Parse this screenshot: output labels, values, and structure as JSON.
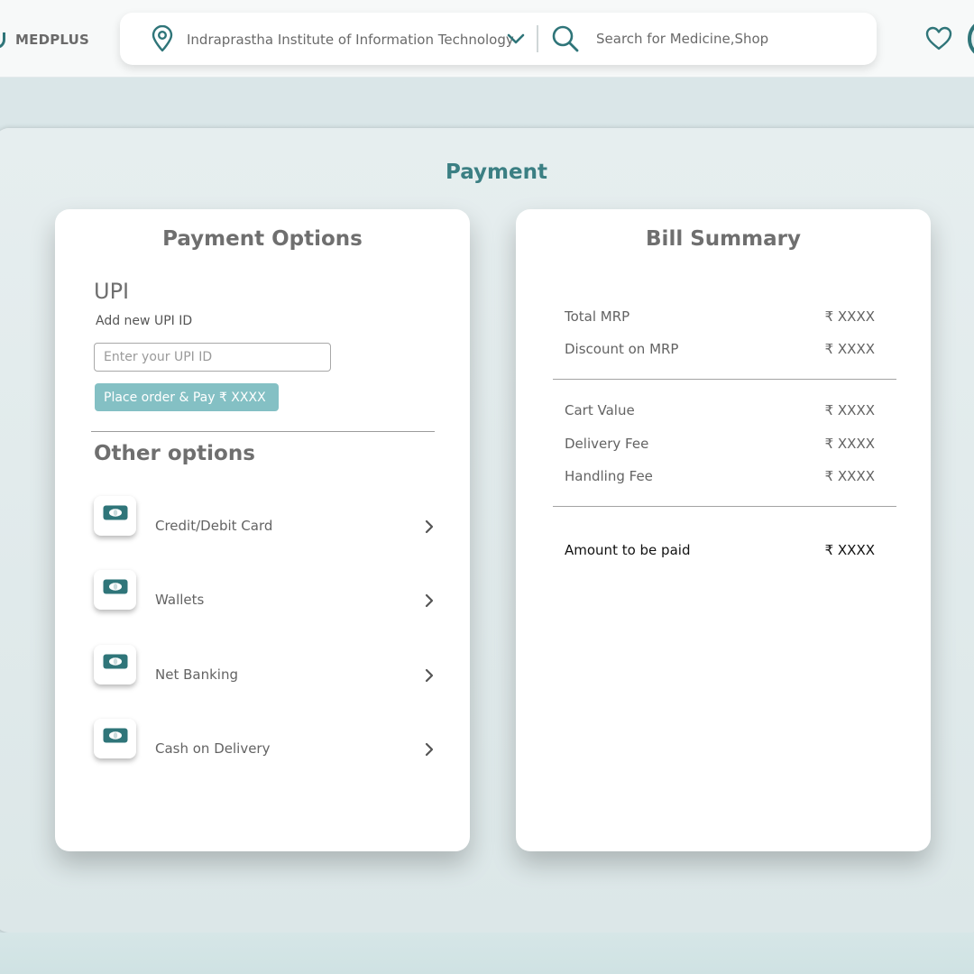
{
  "header": {
    "brand": "MEDPLUS",
    "location": "Indraprastha Institute of Information Technology",
    "search_placeholder": "Search for Medicine,Shop"
  },
  "page": {
    "title": "Payment"
  },
  "payment_options": {
    "title": "Payment Options",
    "upi_heading": "UPI",
    "upi_sub": "Add new UPI ID",
    "upi_placeholder": "Enter your UPI ID",
    "pay_button": "Place order & Pay ₹ XXXX",
    "other_heading": "Other options",
    "options": [
      {
        "label": "Credit/Debit Card"
      },
      {
        "label": "Wallets"
      },
      {
        "label": "Net Banking"
      },
      {
        "label": "Cash on Delivery"
      }
    ]
  },
  "bill_summary": {
    "title": "Bill Summary",
    "rows": [
      {
        "label": "Total MRP",
        "value": "₹ XXXX"
      },
      {
        "label": "Discount on MRP",
        "value": "₹ XXXX"
      },
      {
        "label": "Cart Value",
        "value": "₹ XXXX"
      },
      {
        "label": "Delivery Fee",
        "value": "₹ XXXX"
      },
      {
        "label": "Handling Fee",
        "value": "₹ XXXX"
      }
    ],
    "total": {
      "label": "Amount to be paid",
      "value": "₹ XXXX"
    }
  },
  "colors": {
    "accent": "#2f7579",
    "title_teal": "#3b7f83",
    "button": "#84c0c4",
    "background": "#dbe7e9"
  },
  "icons": [
    "location-pin-icon",
    "chevron-down-icon",
    "search-icon",
    "heart-icon",
    "card-icon",
    "chevron-right-icon"
  ]
}
